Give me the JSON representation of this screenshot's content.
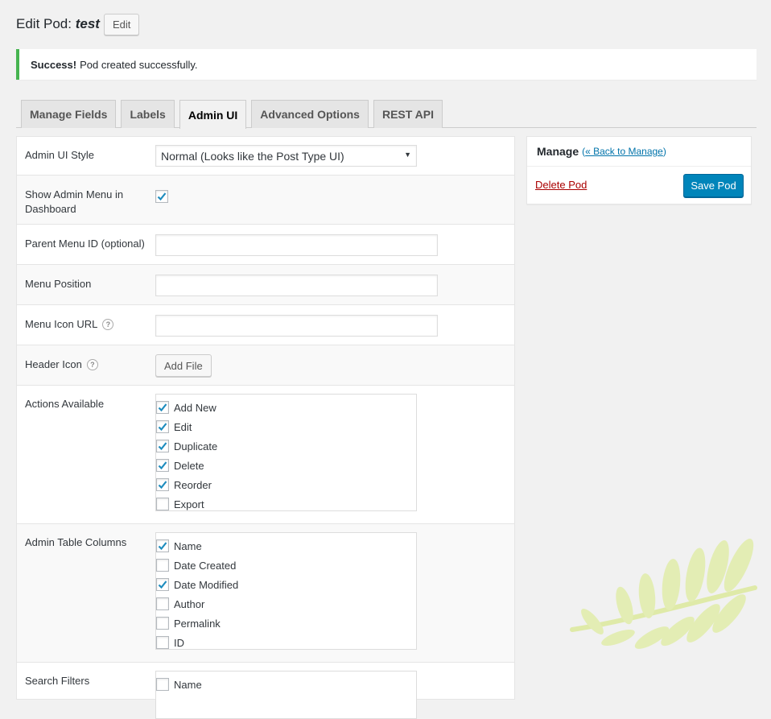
{
  "header": {
    "title_prefix": "Edit Pod:",
    "pod_name": "test",
    "edit_button": "Edit"
  },
  "notice": {
    "strong": "Success!",
    "message": "Pod created successfully.",
    "color": "#46b450"
  },
  "tabs": [
    {
      "label": "Manage Fields",
      "active": false
    },
    {
      "label": "Labels",
      "active": false
    },
    {
      "label": "Admin UI",
      "active": true
    },
    {
      "label": "Advanced Options",
      "active": false
    },
    {
      "label": "REST API",
      "active": false
    }
  ],
  "form": {
    "admin_ui_style": {
      "label": "Admin UI Style",
      "value": "Normal (Looks like the Post Type UI)"
    },
    "show_admin_menu": {
      "label": "Show Admin Menu in Dashboard",
      "checked": true
    },
    "parent_menu_id": {
      "label": "Parent Menu ID (optional)",
      "value": ""
    },
    "menu_position": {
      "label": "Menu Position",
      "value": ""
    },
    "menu_icon_url": {
      "label": "Menu Icon URL",
      "value": "",
      "help": "?"
    },
    "header_icon": {
      "label": "Header Icon",
      "help": "?",
      "button": "Add File"
    },
    "actions_available": {
      "label": "Actions Available",
      "items": [
        {
          "label": "Add New",
          "checked": true
        },
        {
          "label": "Edit",
          "checked": true
        },
        {
          "label": "Duplicate",
          "checked": true
        },
        {
          "label": "Delete",
          "checked": true
        },
        {
          "label": "Reorder",
          "checked": true
        },
        {
          "label": "Export",
          "checked": false
        }
      ]
    },
    "admin_table_columns": {
      "label": "Admin Table Columns",
      "items": [
        {
          "label": "Name",
          "checked": true
        },
        {
          "label": "Date Created",
          "checked": false
        },
        {
          "label": "Date Modified",
          "checked": true
        },
        {
          "label": "Author",
          "checked": false
        },
        {
          "label": "Permalink",
          "checked": false
        },
        {
          "label": "ID",
          "checked": false
        }
      ]
    },
    "search_filters": {
      "label": "Search Filters",
      "items": [
        {
          "label": "Name",
          "checked": false
        }
      ]
    }
  },
  "sidebar": {
    "heading": "Manage",
    "back_link": "« Back to Manage",
    "delete_link": "Delete Pod",
    "save_button": "Save Pod",
    "accent": "#0085ba"
  }
}
